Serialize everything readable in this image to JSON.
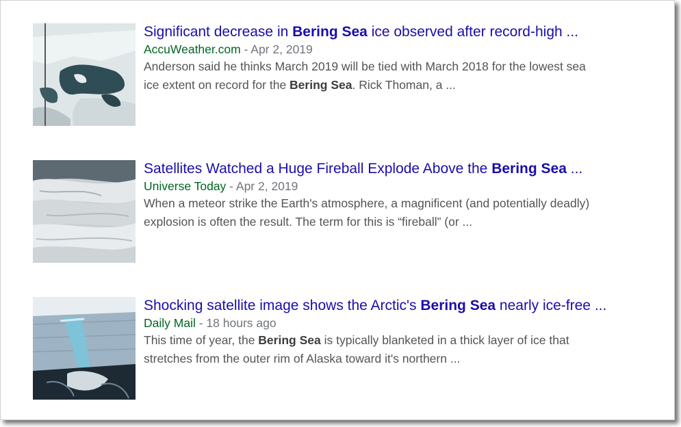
{
  "results": [
    {
      "title_pre": "Significant decrease in ",
      "title_bold": "Bering Sea",
      "title_post": " ice observed after record-high ...",
      "source": "AccuWeather.com",
      "date": "Apr 2, 2019",
      "snippet_line1": "Anderson said he thinks March 2019 will be tied with March 2018 for the lowest sea",
      "snippet_pre": "ice extent on record for the ",
      "snippet_bold": "Bering Sea",
      "snippet_post": ". Rick Thoman, a ..."
    },
    {
      "title_pre": "Satellites Watched a Huge Fireball Explode Above the ",
      "title_bold": "Bering Sea",
      "title_post": " ...",
      "source": "Universe Today",
      "date": "Apr 2, 2019",
      "snippet_line1": "When a meteor strike the Earth's atmosphere, a magnificent (and potentially deadly)",
      "snippet_line2": "explosion is often the result. The term for this is “fireball” (or ..."
    },
    {
      "title_pre": "Shocking satellite image shows the Arctic's ",
      "title_bold": "Bering Sea",
      "title_post": " nearly ice-free ...",
      "source": "Daily Mail",
      "date": "18 hours ago",
      "snippet_pre": "This time of year, the ",
      "snippet_bold": "Bering Sea",
      "snippet_post": " is typically blanketed in a thick layer of ice that",
      "snippet_line2": "stretches from the outer rim of Alaska toward it's northern ..."
    }
  ],
  "separator": " - ",
  "colors": {
    "title": "#1a0dab",
    "source": "#006621",
    "meta": "#70757a",
    "snippet": "#545454"
  }
}
